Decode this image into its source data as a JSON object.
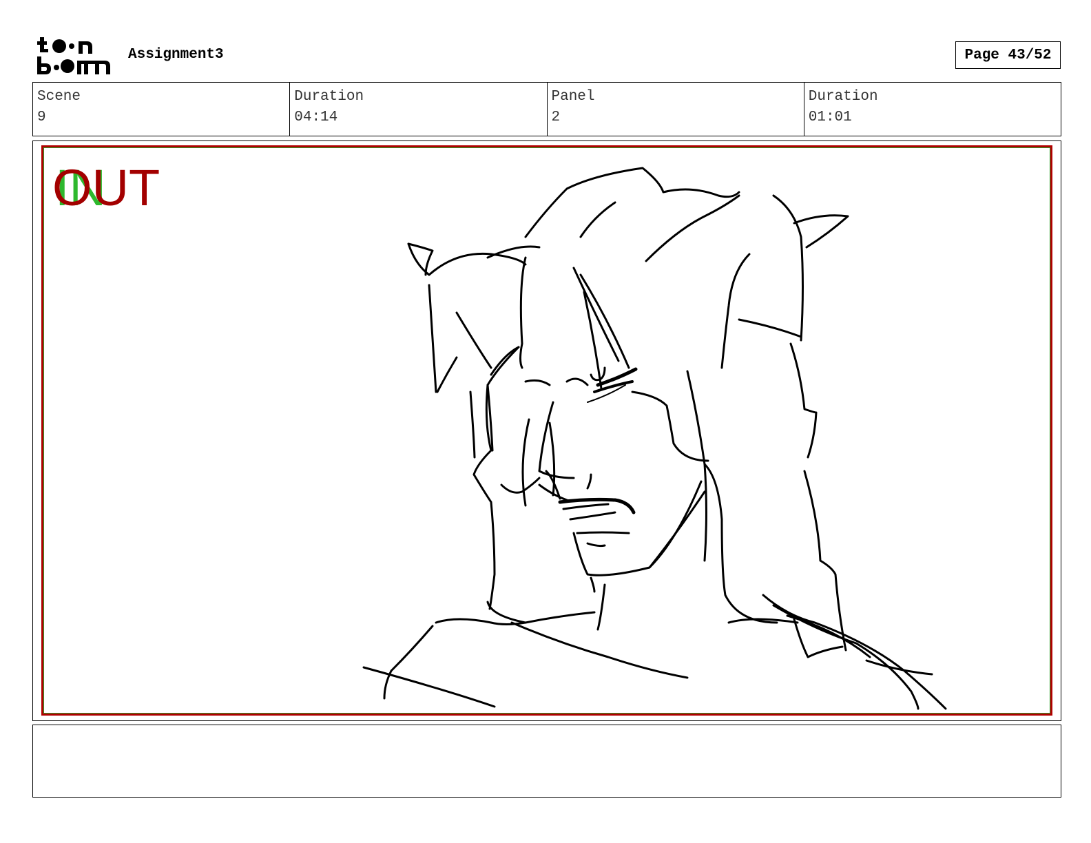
{
  "header": {
    "logo_alt": "toon boom",
    "project_title": "Assignment3",
    "page_indicator": "Page 43/52"
  },
  "info": {
    "scene_label": "Scene",
    "scene_value": "9",
    "scene_duration_label": "Duration",
    "scene_duration_value": "04:14",
    "panel_label": "Panel",
    "panel_value": "2",
    "panel_duration_label": "Duration",
    "panel_duration_value": "01:01"
  },
  "panel": {
    "in_marker": "IN",
    "out_marker": "OUT",
    "colors": {
      "safe_frame": "#b00000",
      "action_frame": "#2aa02a",
      "in_text": "#2eb82e",
      "out_text": "#a30000"
    }
  },
  "notes": {
    "text": ""
  }
}
